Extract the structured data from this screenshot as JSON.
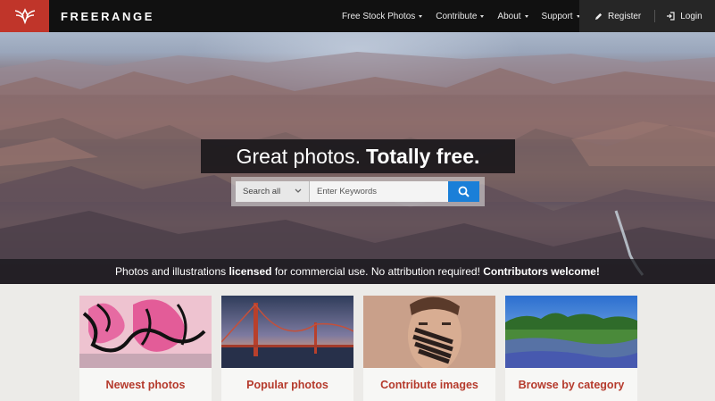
{
  "header": {
    "brand": "FREERANGE",
    "nav": [
      {
        "label": "Free Stock Photos"
      },
      {
        "label": "Contribute"
      },
      {
        "label": "About"
      },
      {
        "label": "Support"
      }
    ],
    "register_label": "Register",
    "login_label": "Login",
    "logo_color": "#c0352a"
  },
  "hero": {
    "headline_regular": "Great photos.",
    "headline_bold": "Totally free.",
    "search": {
      "scope_value": "Search all",
      "placeholder": "Enter Keywords"
    },
    "strip": {
      "part1": "Photos and illustrations ",
      "bold1": "licensed",
      "part2": " for commercial use. No attribution required! ",
      "bold2": "Contributors welcome!"
    }
  },
  "cards": [
    {
      "label": "Newest photos",
      "image": "graffiti"
    },
    {
      "label": "Popular photos",
      "image": "golden-gate-bridge"
    },
    {
      "label": "Contribute images",
      "image": "painted-face-portrait"
    },
    {
      "label": "Browse by category",
      "image": "bluebonnet-field"
    }
  ],
  "colors": {
    "accent": "#b53a2c",
    "search_button": "#1a7fd8"
  }
}
